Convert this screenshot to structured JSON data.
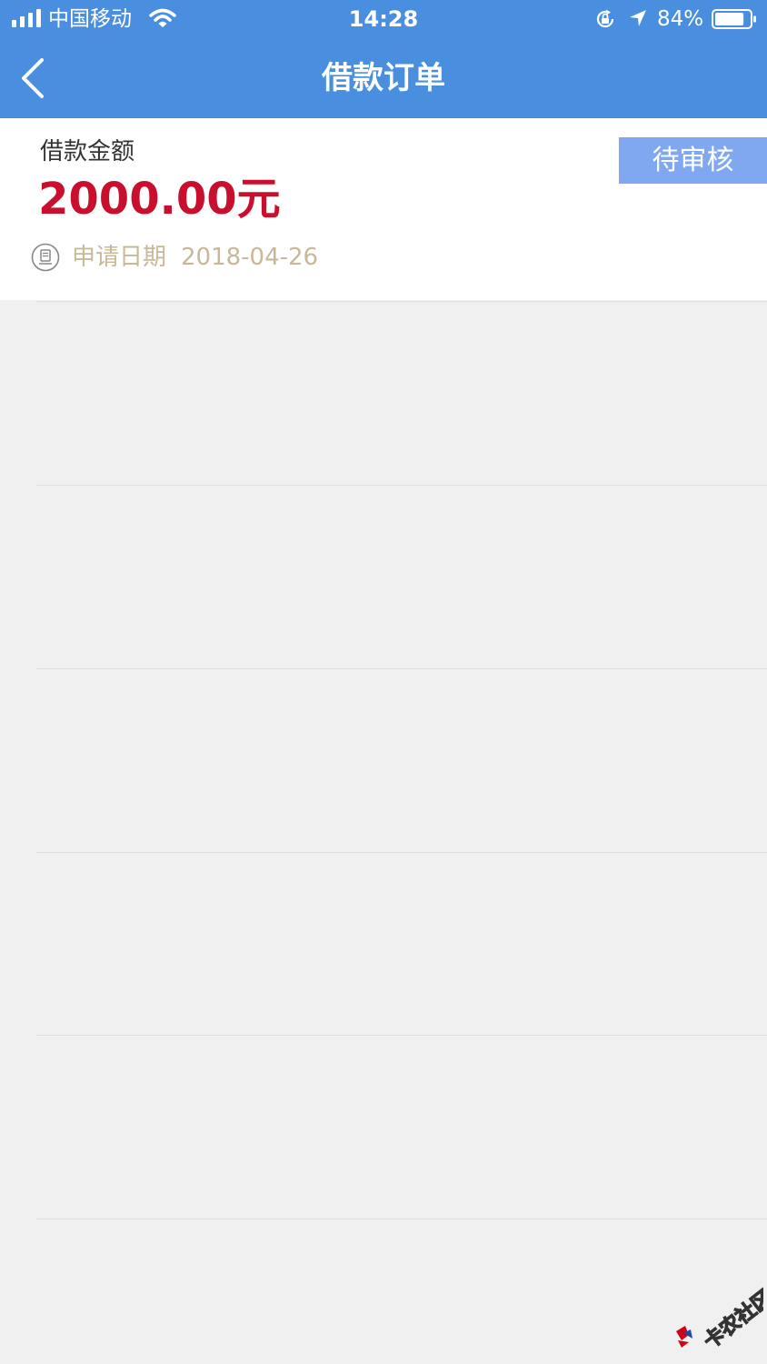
{
  "status_bar": {
    "carrier": "中国移动",
    "time": "14:28",
    "battery_percent": "84%",
    "battery_level": 0.84,
    "icons": [
      "signal-icon",
      "wifi-icon",
      "rotation-lock-icon",
      "location-arrow-icon",
      "battery-icon"
    ]
  },
  "nav": {
    "title": "借款订单",
    "back_icon": "chevron-left-icon"
  },
  "order": {
    "amount_label": "借款金额",
    "amount_value": "2000.00元",
    "status": "待审核",
    "date_label": "申请日期",
    "date_value": "2018-04-26",
    "date_icon": "document-icon"
  },
  "colors": {
    "header": "#4a8fdf",
    "amount": "#c8102e",
    "badge": "#7fa8f0",
    "date_text": "#c9b897",
    "background": "#f0f0f0"
  },
  "watermark_text": "卡农社区"
}
